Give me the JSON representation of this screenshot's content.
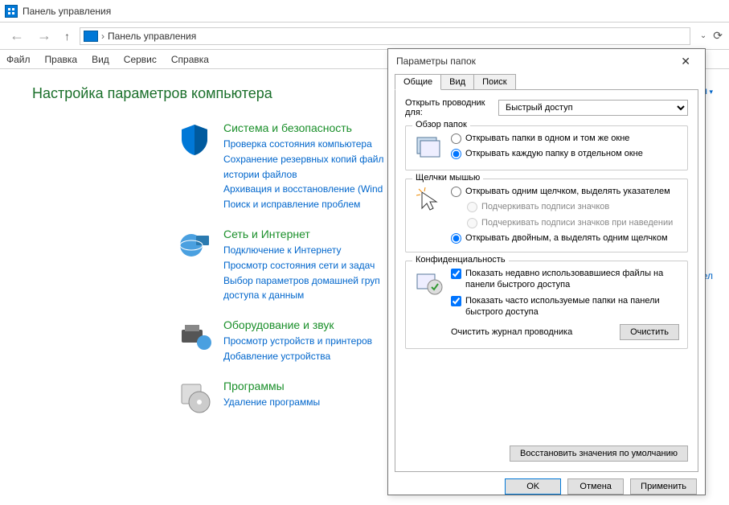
{
  "window": {
    "title": "Панель управления"
  },
  "nav": {
    "address": "Панель управления"
  },
  "menu": [
    "Файл",
    "Правка",
    "Вид",
    "Сервис",
    "Справка"
  ],
  "page": {
    "heading": "Настройка параметров компьютера",
    "category_dropdown": "егория",
    "pixel_text": "сел"
  },
  "categories": [
    {
      "title": "Система и безопасность",
      "links": [
        "Проверка состояния компьютера",
        "Сохранение резервных копий файл",
        "истории файлов",
        "Архивация и восстановление (Wind",
        "Поиск и исправление проблем"
      ]
    },
    {
      "title": "Сеть и Интернет",
      "links": [
        "Подключение к Интернету",
        "Просмотр состояния сети и задач",
        "Выбор параметров домашней груп",
        "доступа к данным"
      ]
    },
    {
      "title": "Оборудование и звук",
      "links": [
        "Просмотр устройств и принтеров",
        "Добавление устройства"
      ]
    },
    {
      "title": "Программы",
      "links": [
        "Удаление программы"
      ]
    }
  ],
  "dialog": {
    "title": "Параметры папок",
    "tabs": [
      "Общие",
      "Вид",
      "Поиск"
    ],
    "open_label": "Открыть проводник для:",
    "open_value": "Быстрый доступ",
    "group_browse": {
      "legend": "Обзор папок",
      "opt1": "Открывать папки в одном и том же окне",
      "opt2": "Открывать каждую папку в отдельном окне"
    },
    "group_click": {
      "legend": "Щелчки мышью",
      "opt1": "Открывать одним щелчком, выделять указателем",
      "opt1a": "Подчеркивать подписи значков",
      "opt1b": "Подчеркивать подписи значков при наведении",
      "opt2": "Открывать двойным, а выделять одним щелчком"
    },
    "group_privacy": {
      "legend": "Конфиденциальность",
      "chk1": "Показать недавно использовавшиеся файлы на панели быстрого доступа",
      "chk2": "Показать часто используемые папки на панели быстрого доступа",
      "clear_label": "Очистить журнал проводника",
      "clear_btn": "Очистить"
    },
    "restore_btn": "Восстановить значения по умолчанию",
    "ok": "OK",
    "cancel": "Отмена",
    "apply": "Применить"
  }
}
